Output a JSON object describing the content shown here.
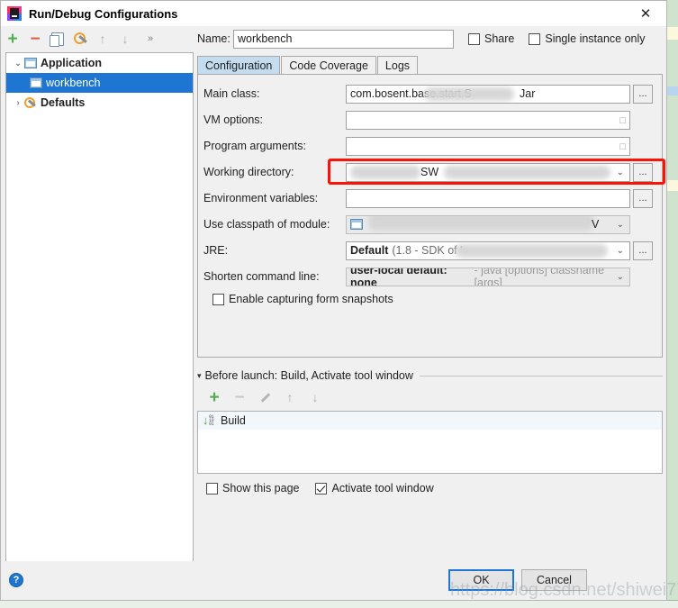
{
  "window": {
    "title": "Run/Debug Configurations",
    "app_icon": "intellij-idea-icon",
    "close_icon": "✕"
  },
  "toolbar": {
    "add": "+",
    "remove": "−",
    "copy_icon": "copy-icon",
    "edit_defaults_icon": "wrench-icon",
    "move_up": "↑",
    "move_down": "↓",
    "overflow": "»"
  },
  "tree": {
    "items": [
      {
        "label": "Application",
        "arrow": "⌄",
        "icon": "application-icon",
        "selected": false,
        "level": 0
      },
      {
        "label": "workbench",
        "arrow": "",
        "icon": "application-icon",
        "selected": true,
        "level": 1
      },
      {
        "label": "Defaults",
        "arrow": "›",
        "icon": "wrench-icon",
        "selected": false,
        "level": 0
      }
    ]
  },
  "name_row": {
    "label": "Name:",
    "value": "workbench",
    "placeholder": "",
    "share_label": "Share",
    "share_checked": false,
    "single_instance_label": "Single instance only",
    "single_instance_checked": false
  },
  "tabs": [
    {
      "label": "Configuration",
      "active": true
    },
    {
      "label": "Code Coverage",
      "active": false
    },
    {
      "label": "Logs",
      "active": false
    }
  ],
  "configuration": {
    "main_class": {
      "label": "Main class:",
      "value": "com.bosent.base.start.S",
      "value_tail": "Jar",
      "browse": "..."
    },
    "vm_options": {
      "label": "VM options:",
      "value": "",
      "expand_icon": "expand-icon"
    },
    "program_arguments": {
      "label": "Program arguments:",
      "value": "",
      "expand_icon": "expand-icon"
    },
    "working_directory": {
      "label": "Working directory:",
      "value": "SW",
      "browse": "...",
      "highlighted": true,
      "highlight_color": "#fb1405"
    },
    "environment_variables": {
      "label": "Environment variables:",
      "value": "",
      "browse": "..."
    },
    "use_classpath_of_module": {
      "label": "Use classpath of module:",
      "value": "V"
    },
    "jre": {
      "label": "JRE:",
      "value": "Default",
      "value_detail": "(1.8 - SDK of '",
      "browse": "..."
    },
    "shorten_command_line": {
      "label": "Shorten command line:",
      "value": "user-local default: none",
      "value_detail": "- java [options] classname [args]"
    },
    "enable_form_snapshots": {
      "label": "Enable capturing form snapshots",
      "checked": false
    }
  },
  "before_launch": {
    "header": "Before launch: Build, Activate tool window",
    "collapse_arrow": "▾",
    "toolbar": {
      "add": "+",
      "remove": "−",
      "edit_icon": "pencil-icon",
      "move_up": "↑",
      "move_down": "↓"
    },
    "items": [
      {
        "label": "Build",
        "icon": "build-icon"
      }
    ],
    "show_this_page": {
      "label": "Show this page",
      "checked": false
    },
    "activate_tool_window": {
      "label": "Activate tool window",
      "checked": true
    }
  },
  "footer": {
    "help_icon": "?",
    "ok_label": "OK",
    "cancel_label": "Cancel"
  },
  "watermark": {
    "text": "https://blog.csdn.net/shiwei77"
  }
}
